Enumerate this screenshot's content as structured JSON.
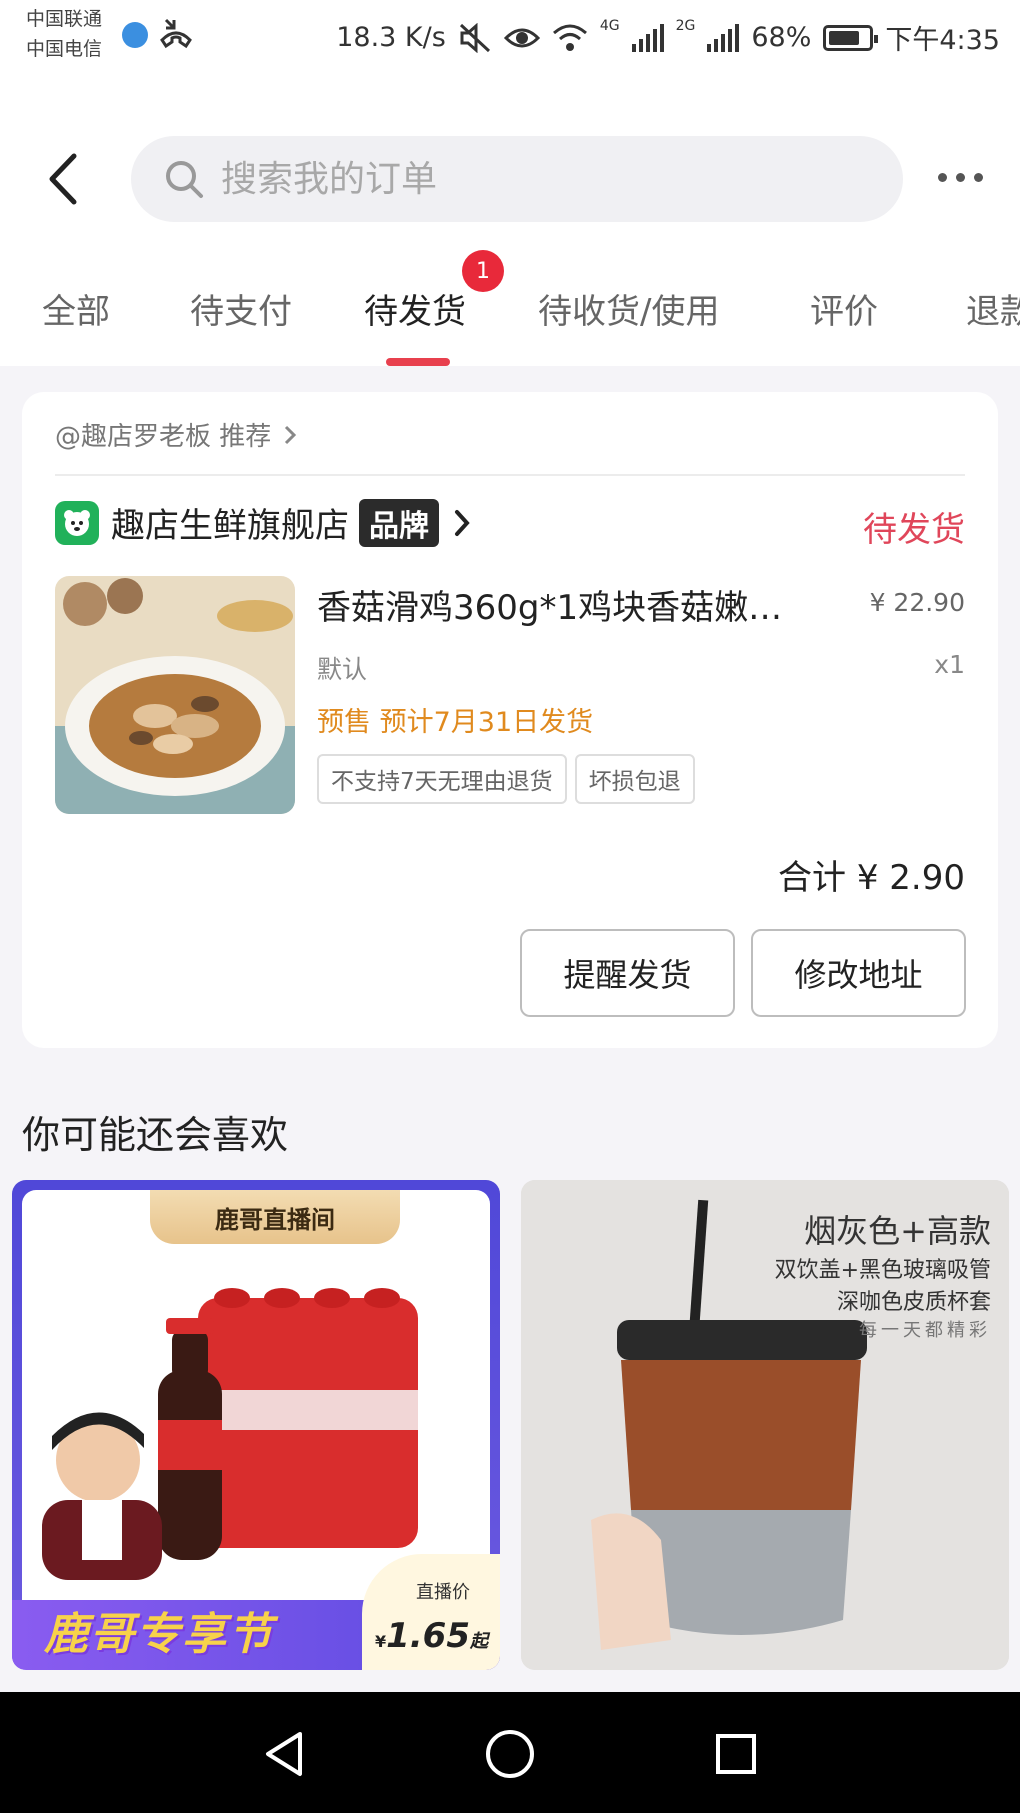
{
  "status_bar": {
    "carrier_1": "中国联通",
    "carrier_2": "中国电信",
    "net_speed": "18.3 K/s",
    "net_1": "4G",
    "net_2": "2G",
    "battery": "68%",
    "time": "下午4:35"
  },
  "header": {
    "search_placeholder": "搜索我的订单"
  },
  "tabs": [
    {
      "label": "全部"
    },
    {
      "label": "待支付"
    },
    {
      "label": "待发货",
      "badge": "1",
      "active": true
    },
    {
      "label": "待收货/使用"
    },
    {
      "label": "评价"
    },
    {
      "label": "退款"
    }
  ],
  "order": {
    "recommend_text": "@趣店罗老板 推荐",
    "shop_name": "趣店生鲜旗舰店",
    "brand_tag": "品牌",
    "status": "待发货",
    "product": {
      "title": "香菇滑鸡360g*1鸡块香菇嫩…",
      "price": "¥ 22.90",
      "spec": "默认",
      "qty": "x1",
      "presale": "预售 预计7月31日发货",
      "tags": [
        "不支持7天无理由退货",
        "坏损包退"
      ]
    },
    "total": "合计 ¥ 2.90",
    "buttons": {
      "remind": "提醒发货",
      "change_address": "修改地址"
    }
  },
  "recommendations": {
    "title": "你可能还会喜欢",
    "items": [
      {
        "live_room": "鹿哥直播间",
        "festival": "鹿哥专享节",
        "price_label": "直播价",
        "price": "1.65",
        "price_suffix": "起",
        "currency": "¥"
      },
      {
        "title": "烟灰色+高款",
        "line1": "双饮盖+黑色玻璃吸管",
        "line2": "深咖色皮质杯套",
        "line3": "每一天都精彩"
      }
    ]
  },
  "colors": {
    "accent_red": "#e8404e",
    "status_pink": "#e0465a",
    "presale_orange": "#e08a1e"
  }
}
